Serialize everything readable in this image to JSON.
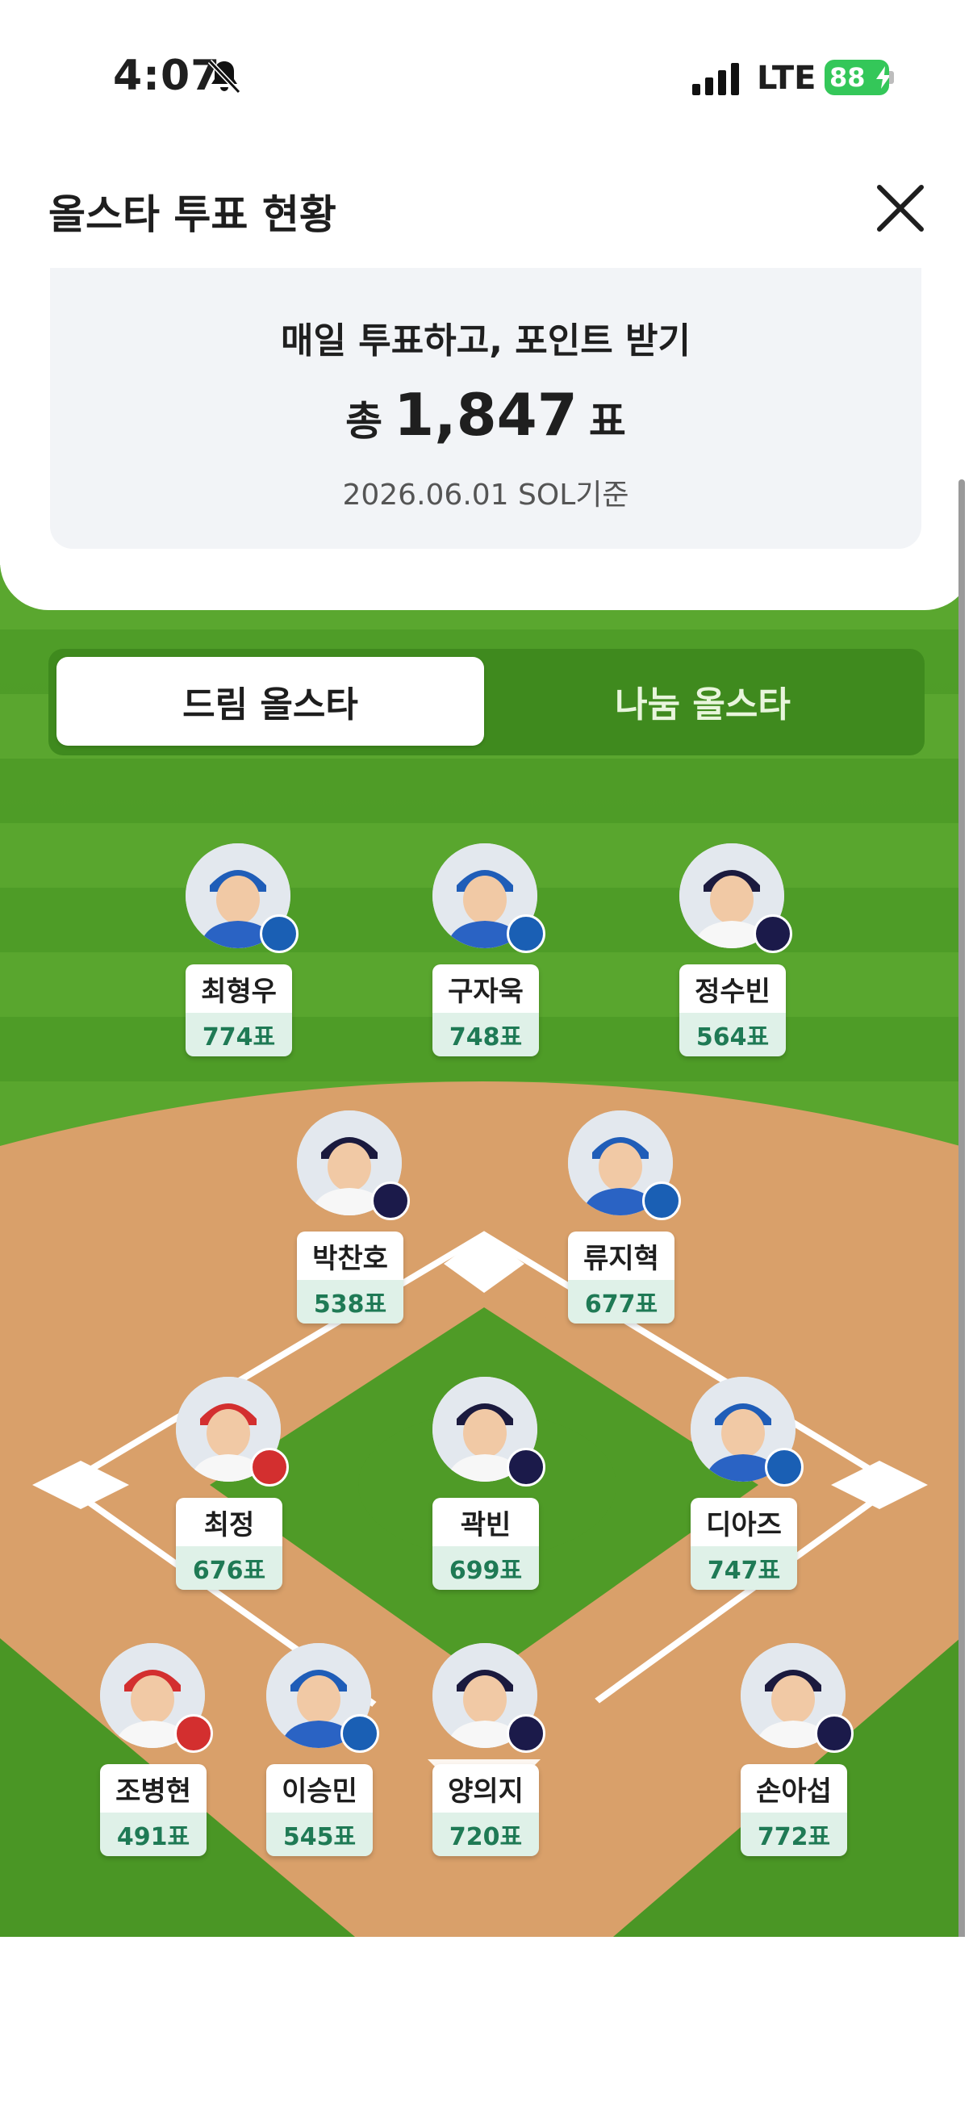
{
  "status_bar": {
    "time": "4:07",
    "network": "LTE",
    "battery": "88"
  },
  "header": {
    "title": "올스타 투표 현황"
  },
  "summary": {
    "headline": "매일 투표하고, 포인트 받기",
    "total_prefix": "총",
    "total_votes": "1,847",
    "total_unit": "표",
    "date_note": "2026.06.01 SOL기준"
  },
  "tabs": [
    {
      "label": "드림 올스타",
      "active": true
    },
    {
      "label": "나눔 올스타",
      "active": false
    }
  ],
  "players": [
    {
      "name": "최형우",
      "votes": "774표",
      "team_badge": "Lions"
    },
    {
      "name": "구자욱",
      "votes": "748표",
      "team_badge": "Lions"
    },
    {
      "name": "정수빈",
      "votes": "564표",
      "team_badge": "Bears"
    },
    {
      "name": "박찬호",
      "votes": "538표",
      "team_badge": "Bears"
    },
    {
      "name": "류지혁",
      "votes": "677표",
      "team_badge": "Lions"
    },
    {
      "name": "최정",
      "votes": "676표",
      "team_badge": "Landers"
    },
    {
      "name": "곽빈",
      "votes": "699표",
      "team_badge": "Bears"
    },
    {
      "name": "디아즈",
      "votes": "747표",
      "team_badge": "Lions"
    },
    {
      "name": "조병현",
      "votes": "491표",
      "team_badge": "Landers"
    },
    {
      "name": "이승민",
      "votes": "545표",
      "team_badge": "Lions"
    },
    {
      "name": "양의지",
      "votes": "720표",
      "team_badge": "Bears"
    },
    {
      "name": "손아섭",
      "votes": "772표",
      "team_badge": "Bears"
    }
  ],
  "colors": {
    "grass": "#4f9b27",
    "dirt": "#d9a06a",
    "vote_text": "#1f7a55",
    "battery": "#34c759"
  }
}
